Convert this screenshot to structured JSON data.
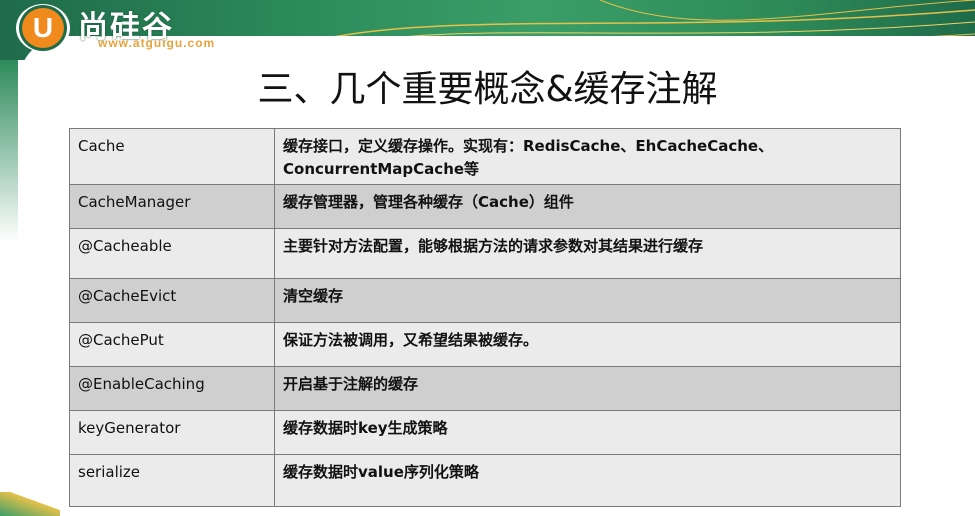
{
  "logo": {
    "letter": "U",
    "chinese": "尚硅谷",
    "url": "www.atguigu.com"
  },
  "title": "三、几个重要概念&缓存注解",
  "table": {
    "rows": [
      {
        "key": "Cache",
        "desc": "缓存接口，定义缓存操作。实现有：RedisCache、EhCacheCache、ConcurrentMapCache等"
      },
      {
        "key": "CacheManager",
        "desc": "缓存管理器，管理各种缓存（Cache）组件"
      },
      {
        "key": "@Cacheable",
        "desc": "主要针对方法配置，能够根据方法的请求参数对其结果进行缓存"
      },
      {
        "key": "@CacheEvict",
        "desc": "清空缓存"
      },
      {
        "key": "@CachePut",
        "desc": "保证方法被调用，又希望结果被缓存。"
      },
      {
        "key": "@EnableCaching",
        "desc": "开启基于注解的缓存"
      },
      {
        "key": "keyGenerator",
        "desc": "缓存数据时key生成策略"
      },
      {
        "key": "serialize",
        "desc": "缓存数据时value序列化策略"
      }
    ]
  }
}
